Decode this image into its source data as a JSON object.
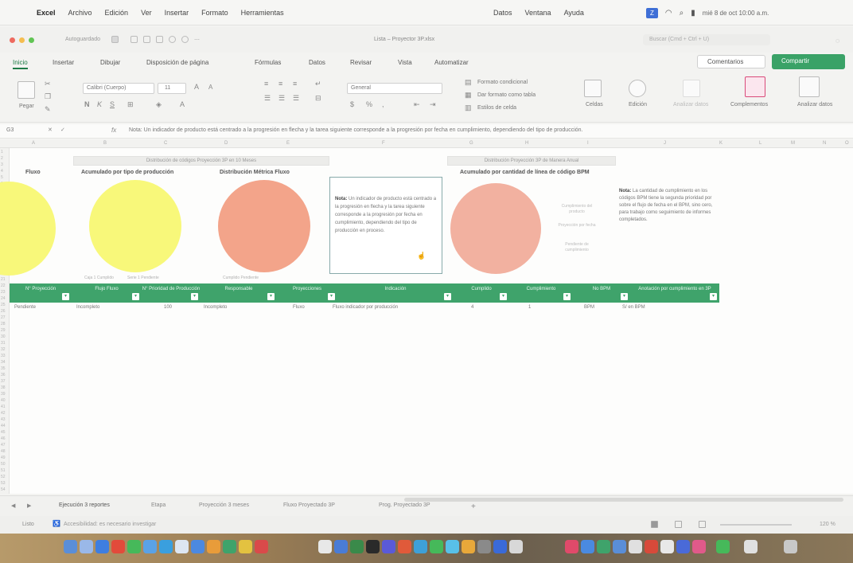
{
  "menubar": {
    "app_name": "Excel",
    "menus": [
      "Archivo",
      "Edición",
      "Ver",
      "Insertar",
      "Formato",
      "Herramientas"
    ],
    "right_menus": [
      "Datos",
      "Ventana",
      "Ayuda"
    ],
    "clock": "mié 8 de oct  10:00 a.m."
  },
  "titlebar": {
    "autosave": "Autoguardado",
    "document_title": "Lista – Proyector 3P.xlsx",
    "search_placeholder": "Buscar (Cmd + Ctrl + U)"
  },
  "ribbon_tabs": [
    "Inicio",
    "Insertar",
    "Dibujar",
    "Disposición de página",
    "Fórmulas",
    "Datos",
    "Revisar",
    "Vista",
    "Automatizar"
  ],
  "active_tab": "Inicio",
  "actions": {
    "comments": "Comentarios",
    "share": "Compartir"
  },
  "ribbon": {
    "paste": "Pegar",
    "font_name": "Calibri (Cuerpo)",
    "font_size": "11",
    "number_format": "General",
    "styles": [
      "Formato condicional",
      "Dar formato como tabla",
      "Estilos de celda"
    ],
    "groups": [
      "Celdas",
      "Edición",
      "Analizar datos",
      "Complementos",
      "Analizar datos"
    ]
  },
  "formula_bar": {
    "cell_ref": "G3",
    "formula": "Nota: Un indicador de producto está centrado a la progresión en flecha y la tarea siguiente corresponde a la progresión por fecha en cumplimiento, dependiendo del tipo de producción."
  },
  "sheet": {
    "columns": [
      "A",
      "B",
      "C",
      "D",
      "E",
      "F",
      "G",
      "H",
      "I",
      "J",
      "K",
      "L",
      "M",
      "N",
      "O"
    ],
    "group_titles": [
      "Distribución de códigos Proyección 3P en 10 Meses",
      "Distribución Proyección 3P de Manera Anual"
    ],
    "chart_titles": [
      "Fluxo",
      "Acumulado por tipo de producción",
      "Distribución Métrica Fluxo",
      "Acumulado por cantidad de línea de código BPM"
    ],
    "legends": [
      "Caja 1  Cumplido",
      "Serie 1  Pendiente",
      "Cumplido  Pendiente"
    ],
    "note1": {
      "bold": "Nota:",
      "text": "Un indicador de producto está centrado a la progresión en flecha y la tarea siguiente corresponde a la progresión por fecha en cumplimiento, dependiendo del tipo de producción en proceso."
    },
    "note2": {
      "bold": "Nota:",
      "text": "La cantidad de cumplimiento en los códigos BPM tiene la segunda prioridad por sobre el flujo de fecha en el BPM, sino cero, para trabajo como seguimiento de informes completados."
    },
    "side_labels": [
      "Cumplimiento del producto",
      "Proyección por fecha",
      "Pendiente de cumplimiento"
    ],
    "table_headers": [
      "N° Proyección",
      "Flujo Fluxo",
      "N° Prioridad de Producción",
      "Responsable",
      "Proyecciones",
      "Indicación",
      "Cumplido",
      "Cumplimiento",
      "No BPM",
      "Anotación por cumplimiento en 3P"
    ],
    "table_row": [
      "Pendiente",
      "Incompleto",
      "100",
      "Incompleto",
      "Fluxo",
      "Fluxo indicador por producción",
      "4",
      "1",
      "BPM",
      "S/ en BPM"
    ]
  },
  "sheet_tabs": [
    "Ejecución 3 reportes",
    "Etapa",
    "Proyección 3 meses",
    "Fluxo Proyectado 3P",
    "Prog. Proyectado 3P"
  ],
  "status": {
    "ready": "Listo",
    "accessibility": "Accesibilidad: es necesario investigar",
    "zoom": "120 %"
  },
  "colors": {
    "accent_green": "#3fa36b",
    "pie_yellow": "#f8f87a",
    "pie_salmon": "#f3a48a",
    "pie_salmon_light": "#f2b1a0"
  }
}
